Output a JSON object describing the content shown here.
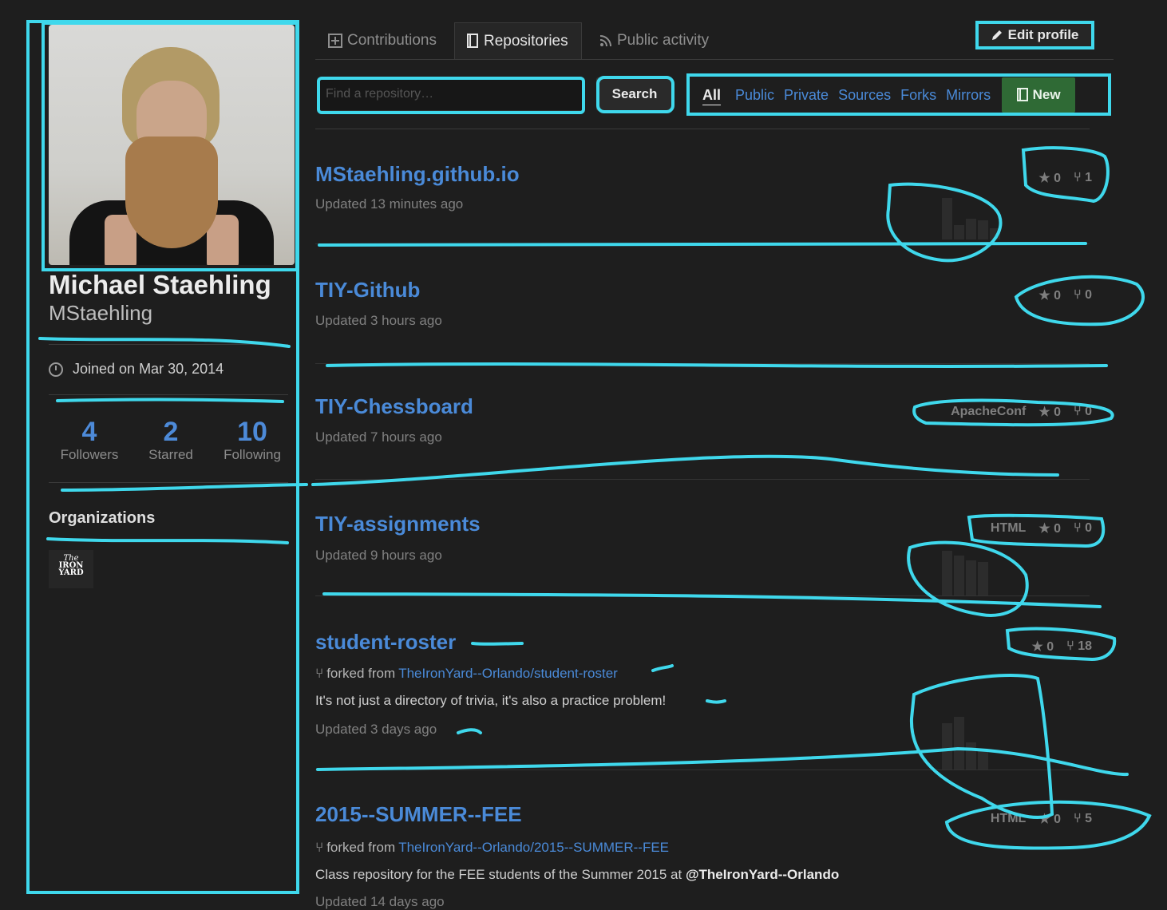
{
  "profile": {
    "full_name": "Michael Staehling",
    "login": "MStaehling",
    "joined": "Joined on Mar 30, 2014",
    "stats": [
      {
        "value": "4",
        "label": "Followers"
      },
      {
        "value": "2",
        "label": "Starred"
      },
      {
        "value": "10",
        "label": "Following"
      }
    ],
    "organizations_title": "Organizations",
    "org_logo_text": [
      "The",
      "IRON",
      "YARD"
    ]
  },
  "tabs": [
    {
      "label": "Contributions",
      "icon": "plus-square-icon"
    },
    {
      "label": "Repositories",
      "icon": "repo-icon"
    },
    {
      "label": "Public activity",
      "icon": "rss-icon"
    }
  ],
  "edit_profile_label": "Edit profile",
  "search": {
    "placeholder": "Find a repository…",
    "button": "Search"
  },
  "filters": [
    "All",
    "Public",
    "Private",
    "Sources",
    "Forks",
    "Mirrors"
  ],
  "new_button": "New",
  "repos": [
    {
      "name": "MStaehling.github.io",
      "updated": "Updated 13 minutes ago",
      "language": "",
      "stars": "0",
      "forks": "1"
    },
    {
      "name": "TIY-Github",
      "updated": "Updated 3 hours ago",
      "language": "",
      "stars": "0",
      "forks": "0"
    },
    {
      "name": "TIY-Chessboard",
      "updated": "Updated 7 hours ago",
      "language": "ApacheConf",
      "stars": "0",
      "forks": "0"
    },
    {
      "name": "TIY-assignments",
      "updated": "Updated 9 hours ago",
      "language": "HTML",
      "stars": "0",
      "forks": "0"
    },
    {
      "name": "student-roster",
      "forked_prefix": "forked from",
      "forked_from": "TheIronYard--Orlando/student-roster",
      "description": "It's not just a directory of trivia, it's also a practice problem!",
      "updated": "Updated 3 days ago",
      "language": "",
      "stars": "0",
      "forks": "18"
    },
    {
      "name": "2015--SUMMER--FEE",
      "forked_prefix": "forked from",
      "forked_from": "TheIronYard--Orlando/2015--SUMMER--FEE",
      "description": "Class repository for the FEE students of the Summer 2015 at ",
      "mention": "@TheIronYard--Orlando",
      "updated": "Updated 14 days ago",
      "language": "HTML",
      "stars": "0",
      "forks": "5"
    }
  ],
  "colors": {
    "accent": "#4a8ad8",
    "annotation": "#3fd8ec",
    "new_button": "#2f6a35",
    "background": "#1e1e1e"
  }
}
